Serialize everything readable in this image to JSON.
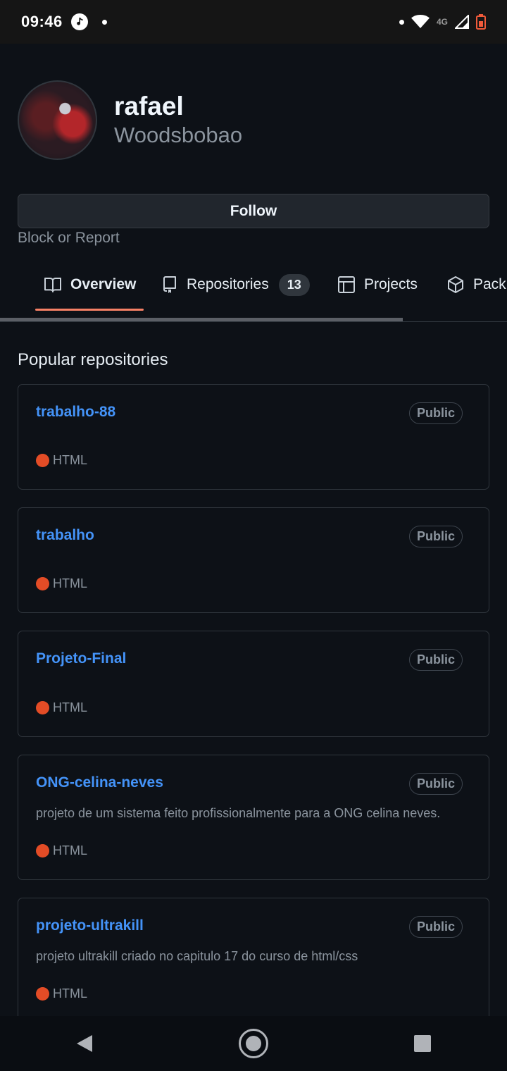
{
  "status_bar": {
    "time": "09:46",
    "network": "4G",
    "icons": [
      "music-app-icon",
      "notification-dot",
      "wifi-icon",
      "cell-signal-icon",
      "battery-icon"
    ]
  },
  "profile": {
    "display_name": "rafael",
    "login": "Woodsbobao",
    "follow_label": "Follow",
    "block_label": "Block or Report"
  },
  "tabs": [
    {
      "label": "Overview",
      "icon": "book-icon",
      "active": true
    },
    {
      "label": "Repositories",
      "icon": "repo-icon",
      "count": "13"
    },
    {
      "label": "Projects",
      "icon": "table-icon"
    },
    {
      "label": "Pack",
      "icon": "package-icon"
    }
  ],
  "popular": {
    "title": "Popular repositories",
    "repos": [
      {
        "name": "trabalho-88",
        "visibility": "Public",
        "description": "",
        "language": "HTML"
      },
      {
        "name": "trabalho",
        "visibility": "Public",
        "description": "",
        "language": "HTML"
      },
      {
        "name": "Projeto-Final",
        "visibility": "Public",
        "description": "",
        "language": "HTML"
      },
      {
        "name": "ONG-celina-neves",
        "visibility": "Public",
        "description": "projeto de um sistema feito profissionalmente para a ONG celina neves.",
        "language": "HTML"
      },
      {
        "name": "projeto-ultrakill",
        "visibility": "Public",
        "description": "projeto ultrakill criado no capitulo 17 do curso de html/css",
        "language": "HTML"
      }
    ]
  },
  "colors": {
    "background": "#0d1117",
    "link": "#4493f8",
    "html_language": "#e34c26",
    "active_tab_underline": "#f78166"
  },
  "nav_bar": [
    "back-icon",
    "home-icon",
    "recents-icon"
  ]
}
